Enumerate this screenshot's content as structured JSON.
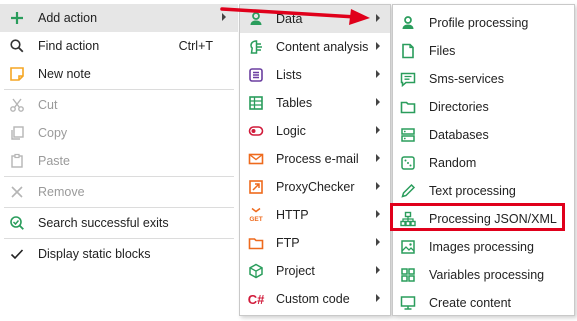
{
  "main_menu": {
    "items": [
      {
        "label": "Add action",
        "icon": "plus-icon",
        "submenu": true
      },
      {
        "label": "Find action",
        "icon": "search-icon",
        "shortcut": "Ctrl+T"
      },
      {
        "label": "New note",
        "icon": "note-icon"
      },
      {
        "label": "Cut",
        "icon": "scissors-icon",
        "disabled": true
      },
      {
        "label": "Copy",
        "icon": "copy-icon",
        "disabled": true
      },
      {
        "label": "Paste",
        "icon": "paste-icon",
        "disabled": true
      },
      {
        "label": "Remove",
        "icon": "close-icon",
        "disabled": true
      },
      {
        "label": "Search successful exits",
        "icon": "search-check-icon"
      },
      {
        "label": "Display static blocks",
        "icon": "checkmark-icon"
      }
    ]
  },
  "action_menu": {
    "items": [
      {
        "label": "Data",
        "icon": "data-icon"
      },
      {
        "label": "Content analysis",
        "icon": "brain-icon"
      },
      {
        "label": "Lists",
        "icon": "list-icon"
      },
      {
        "label": "Tables",
        "icon": "table-icon"
      },
      {
        "label": "Logic",
        "icon": "logic-icon"
      },
      {
        "label": "Process e-mail",
        "icon": "email-icon"
      },
      {
        "label": "ProxyChecker",
        "icon": "proxy-icon"
      },
      {
        "label": "HTTP",
        "icon": "http-get-icon",
        "icon_text": "GET"
      },
      {
        "label": "FTP",
        "icon": "ftp-folder-icon"
      },
      {
        "label": "Project",
        "icon": "cube-icon"
      },
      {
        "label": "Custom code",
        "icon": "csharp-icon",
        "icon_text": "C#"
      }
    ]
  },
  "data_menu": {
    "items": [
      {
        "label": "Profile processing",
        "icon": "profile-icon"
      },
      {
        "label": "Files",
        "icon": "file-icon"
      },
      {
        "label": "Sms-services",
        "icon": "sms-icon"
      },
      {
        "label": "Directories",
        "icon": "folder-icon"
      },
      {
        "label": "Databases",
        "icon": "database-icon"
      },
      {
        "label": "Random",
        "icon": "dice-icon"
      },
      {
        "label": "Text processing",
        "icon": "pencil-icon"
      },
      {
        "label": "Processing JSON/XML",
        "icon": "hierarchy-icon",
        "highlighted": true
      },
      {
        "label": "Images processing",
        "icon": "image-icon"
      },
      {
        "label": "Variables processing",
        "icon": "grid-icon"
      },
      {
        "label": "Create content",
        "icon": "monitor-icon"
      }
    ]
  },
  "colors": {
    "green": "#2a9d5c",
    "red_highlight": "#e0001b",
    "purple": "#6b3fa0",
    "orange": "#ee6a1d",
    "note_orange": "#f5a623",
    "gray_disabled": "#9a9a9a"
  }
}
